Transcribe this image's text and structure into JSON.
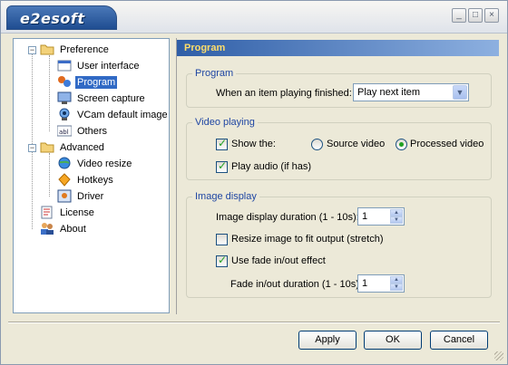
{
  "window": {
    "title": "e2esoft",
    "controls": {
      "minimize": "_",
      "maximize": "□",
      "close": "×"
    }
  },
  "tree": {
    "nodes": [
      {
        "label": "Preference",
        "icon": "folder-open-icon",
        "expanded": true
      },
      {
        "label": "User interface",
        "icon": "window-icon"
      },
      {
        "label": "Program",
        "icon": "program-icon",
        "selected": true
      },
      {
        "label": "Screen capture",
        "icon": "screen-capture-icon"
      },
      {
        "label": "VCam default image",
        "icon": "webcam-icon"
      },
      {
        "label": "Others",
        "icon": "abl-icon"
      },
      {
        "label": "Advanced",
        "icon": "folder-open-icon",
        "expanded": true
      },
      {
        "label": "Video resize",
        "icon": "globe-icon"
      },
      {
        "label": "Hotkeys",
        "icon": "hotkey-icon"
      },
      {
        "label": "Driver",
        "icon": "driver-icon"
      },
      {
        "label": "License",
        "icon": "license-icon"
      },
      {
        "label": "About",
        "icon": "users-icon"
      }
    ]
  },
  "panel": {
    "header": "Program",
    "program": {
      "title": "Program",
      "label": "When an item playing finished:",
      "select_value": "Play next item"
    },
    "video": {
      "title": "Video playing",
      "show_label": "Show the:",
      "show_checked": true,
      "source_label": "Source video",
      "processed_label": "Processed video",
      "selected": "processed",
      "audio_label": "Play audio (if has)",
      "audio_checked": true
    },
    "image": {
      "title": "Image display",
      "duration_label": "Image display duration (1 - 10s):",
      "duration_value": "1",
      "resize_label": "Resize image to fit output (stretch)",
      "resize_checked": false,
      "fade_label": "Use fade in/out effect",
      "fade_checked": true,
      "fade_duration_label": "Fade in/out duration (1 - 10s):",
      "fade_duration_value": "1"
    }
  },
  "buttons": {
    "apply": "Apply",
    "ok": "OK",
    "cancel": "Cancel"
  },
  "colors": {
    "accent": "#316ac5",
    "header_text": "#ffde6a",
    "group_title": "#1f46a3"
  }
}
